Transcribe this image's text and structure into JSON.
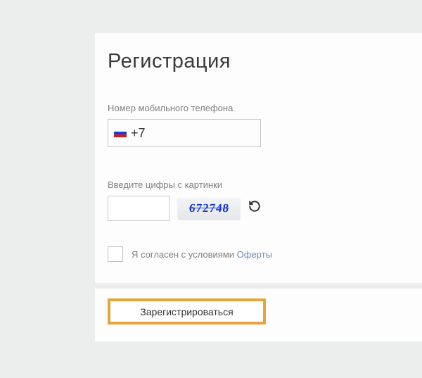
{
  "title": "Регистрация",
  "phone": {
    "label": "Номер мобильного телефона",
    "prefix": "+7",
    "value": ""
  },
  "captcha": {
    "label": "Введите цифры с картинки",
    "value": "",
    "image_text": "672748"
  },
  "agreement": {
    "text": "Я согласен с условиями",
    "link_text": "Оферты",
    "checked": false
  },
  "submit_label": "Зарегистрироваться"
}
